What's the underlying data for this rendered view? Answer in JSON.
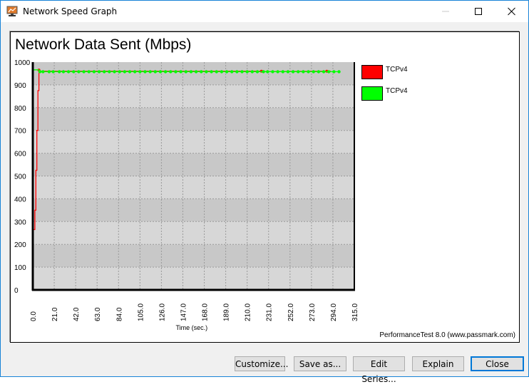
{
  "window": {
    "title": "Network Speed Graph",
    "icon": "monitor-chart-icon",
    "controls": [
      "minimize-icon",
      "maximize-icon",
      "close-icon"
    ]
  },
  "chart_data": {
    "type": "line",
    "title": "Network Data Sent (Mbps)",
    "xlabel": "Time (sec.)",
    "ylabel": "",
    "xlim": [
      0,
      315
    ],
    "ylim": [
      0,
      1000
    ],
    "x_ticks": [
      "0.0",
      "21.0",
      "42.0",
      "63.0",
      "84.0",
      "105.0",
      "126.0",
      "147.0",
      "168.0",
      "189.0",
      "210.0",
      "231.0",
      "252.0",
      "273.0",
      "294.0",
      "315.0"
    ],
    "y_ticks": [
      "0",
      "100",
      "200",
      "300",
      "400",
      "500",
      "600",
      "700",
      "800",
      "900",
      "1000"
    ],
    "grid": true,
    "legend_position": "right",
    "series": [
      {
        "name": "TCPv4",
        "color": "#ff0000",
        "points": [
          [
            0,
            265
          ],
          [
            2,
            265
          ],
          [
            2,
            350
          ],
          [
            3,
            350
          ],
          [
            3,
            525
          ],
          [
            4,
            525
          ],
          [
            4,
            700
          ],
          [
            5,
            700
          ],
          [
            5,
            875
          ],
          [
            6,
            875
          ],
          [
            6,
            965
          ],
          [
            6,
            960
          ],
          [
            223,
            960
          ],
          [
            224,
            962
          ],
          [
            225,
            958
          ],
          [
            287,
            960
          ],
          [
            288,
            962
          ],
          [
            290,
            958
          ],
          [
            292,
            960
          ]
        ]
      },
      {
        "name": "TCPv4",
        "color": "#00ff00",
        "points": [
          [
            0,
            966
          ],
          [
            6,
            966
          ],
          [
            7,
            958
          ],
          [
            10,
            958
          ],
          [
            16,
            958
          ],
          [
            20,
            958
          ],
          [
            26,
            958
          ],
          [
            30,
            958
          ],
          [
            35,
            958
          ],
          [
            40,
            958
          ],
          [
            45,
            958
          ],
          [
            50,
            958
          ],
          [
            55,
            958
          ],
          [
            60,
            958
          ],
          [
            65,
            958
          ],
          [
            70,
            958
          ],
          [
            75,
            958
          ],
          [
            80,
            958
          ],
          [
            85,
            958
          ],
          [
            90,
            958
          ],
          [
            95,
            958
          ],
          [
            100,
            958
          ],
          [
            105,
            958
          ],
          [
            110,
            958
          ],
          [
            115,
            958
          ],
          [
            120,
            958
          ],
          [
            125,
            958
          ],
          [
            130,
            958
          ],
          [
            135,
            958
          ],
          [
            140,
            958
          ],
          [
            145,
            958
          ],
          [
            150,
            958
          ],
          [
            155,
            958
          ],
          [
            160,
            958
          ],
          [
            165,
            958
          ],
          [
            170,
            958
          ],
          [
            175,
            958
          ],
          [
            180,
            958
          ],
          [
            185,
            958
          ],
          [
            190,
            958
          ],
          [
            195,
            958
          ],
          [
            200,
            958
          ],
          [
            205,
            958
          ],
          [
            210,
            958
          ],
          [
            215,
            958
          ],
          [
            220,
            958
          ],
          [
            226,
            958
          ],
          [
            230,
            958
          ],
          [
            235,
            958
          ],
          [
            240,
            958
          ],
          [
            245,
            958
          ],
          [
            250,
            958
          ],
          [
            255,
            958
          ],
          [
            260,
            958
          ],
          [
            265,
            958
          ],
          [
            270,
            958
          ],
          [
            275,
            958
          ],
          [
            280,
            958
          ],
          [
            285,
            958
          ],
          [
            290,
            958
          ],
          [
            295,
            958
          ],
          [
            300,
            958
          ]
        ]
      }
    ],
    "footer": "PerformanceTest 8.0 (www.passmark.com)"
  },
  "buttons": {
    "customize": "Customize...",
    "save_as": "Save as...",
    "edit_series": "Edit Series...",
    "explain": "Explain",
    "close": "Close"
  }
}
